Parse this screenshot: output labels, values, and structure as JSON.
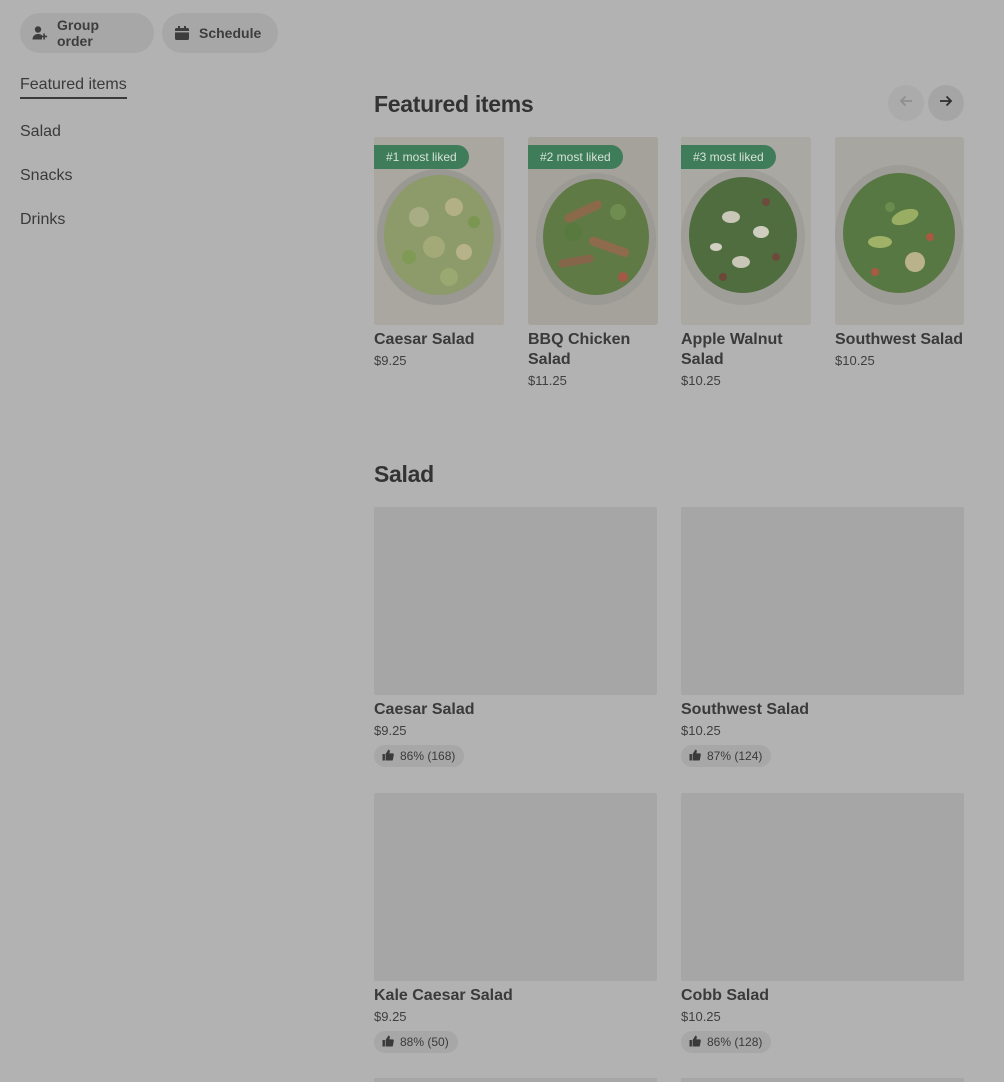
{
  "top_actions": {
    "group_order": {
      "label": "Group order",
      "icon": "add-person-icon"
    },
    "schedule": {
      "label": "Schedule",
      "icon": "calendar-icon"
    }
  },
  "sidebar": {
    "items": [
      {
        "label": "Featured items",
        "active": true
      },
      {
        "label": "Salad"
      },
      {
        "label": "Snacks"
      },
      {
        "label": "Drinks"
      }
    ]
  },
  "featured": {
    "heading": "Featured items",
    "prev_icon": "arrow-left-icon",
    "next_icon": "arrow-right-icon",
    "items": [
      {
        "badge": "#1 most liked",
        "name": "Caesar Salad",
        "price": "$9.25"
      },
      {
        "badge": "#2 most liked",
        "name": "BBQ Chicken Salad",
        "price": "$11.25"
      },
      {
        "badge": "#3 most liked",
        "name": "Apple Walnut Salad",
        "price": "$10.25"
      },
      {
        "badge": "",
        "name": "Southwest Salad",
        "price": "$10.25"
      }
    ]
  },
  "salad": {
    "heading": "Salad",
    "items": [
      {
        "name": "Caesar Salad",
        "price": "$9.25",
        "rating": "86% (168)"
      },
      {
        "name": "Southwest Salad",
        "price": "$10.25",
        "rating": "87% (124)"
      },
      {
        "name": "Kale Caesar Salad",
        "price": "$9.25",
        "rating": "88% (50)"
      },
      {
        "name": "Cobb Salad",
        "price": "$10.25",
        "rating": "86% (128)"
      }
    ]
  },
  "colors": {
    "overlay_bg": "#b2b2b2",
    "badge_green": "#3f7c5a",
    "pill_bg": "#a7a7a7"
  }
}
